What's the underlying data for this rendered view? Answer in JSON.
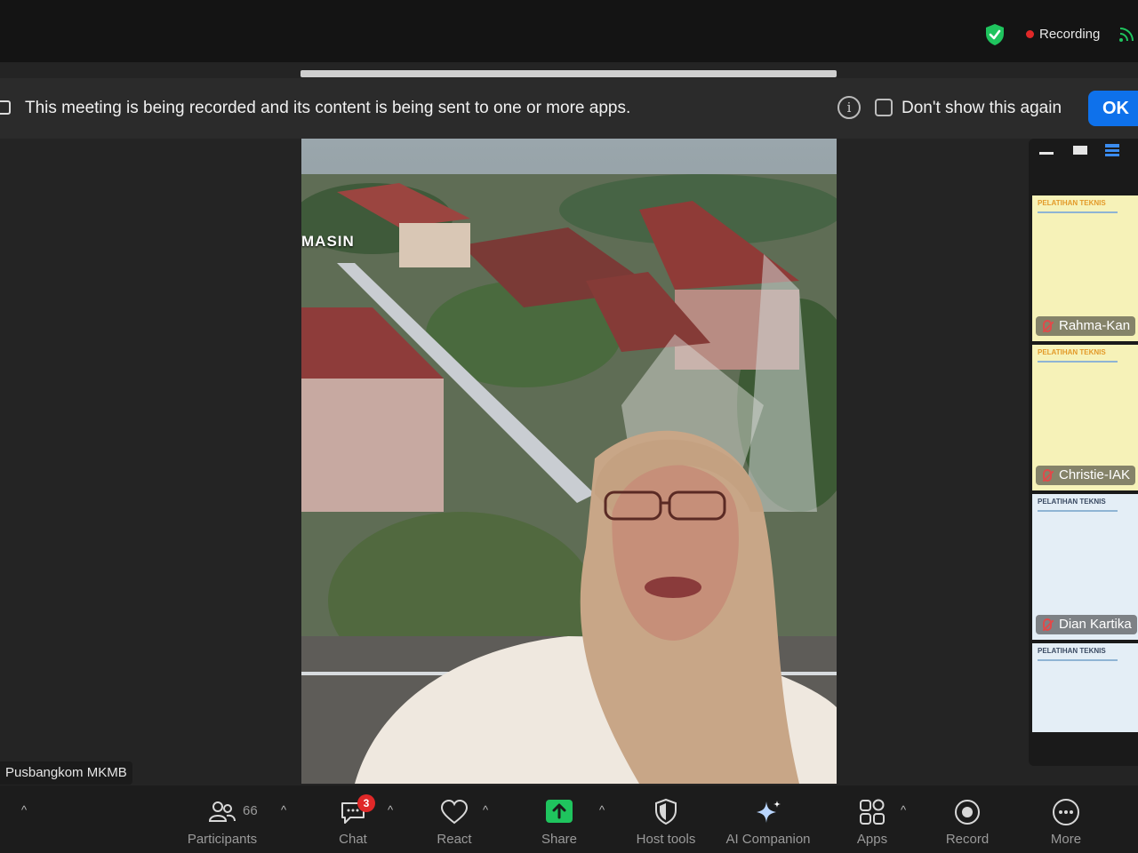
{
  "status": {
    "recording_label": "Recording",
    "colors": {
      "recording_dot": "#e02828",
      "encryption_shield": "#1fc45e",
      "accent": "#0e71eb"
    },
    "icons": [
      "shield-check-icon",
      "record-dot-icon",
      "feed-icon"
    ]
  },
  "notice": {
    "text": "This meeting is being recorded and its content is being sent to one or more apps.",
    "dont_show_label": "Don't show this again",
    "dont_show_checked": false,
    "ok_label": "OK"
  },
  "speaker": {
    "name": "Pusbangkom MKMB",
    "background_text": "MASIN"
  },
  "gallery": {
    "tiles": [
      {
        "name": "Rahma-Kan",
        "slide_title": "PELATIHAN TEKNIS",
        "muted": true
      },
      {
        "name": "Christie-IAK",
        "slide_title": "PELATIHAN TEKNIS",
        "muted": true
      },
      {
        "name": "Dian Kartika",
        "slide_title": "PELATIHAN TEKNIS",
        "muted": true
      },
      {
        "name": "",
        "slide_title": "PELATIHAN TEKNIS",
        "muted": false
      }
    ]
  },
  "toolbar": {
    "participants": {
      "label": "Participants",
      "count": "66"
    },
    "chat": {
      "label": "Chat",
      "badge": "3"
    },
    "react": {
      "label": "React"
    },
    "share": {
      "label": "Share"
    },
    "host_tools": {
      "label": "Host tools"
    },
    "ai_companion": {
      "label": "AI Companion"
    },
    "apps": {
      "label": "Apps"
    },
    "record": {
      "label": "Record"
    },
    "more": {
      "label": "More"
    },
    "caret": "^"
  }
}
